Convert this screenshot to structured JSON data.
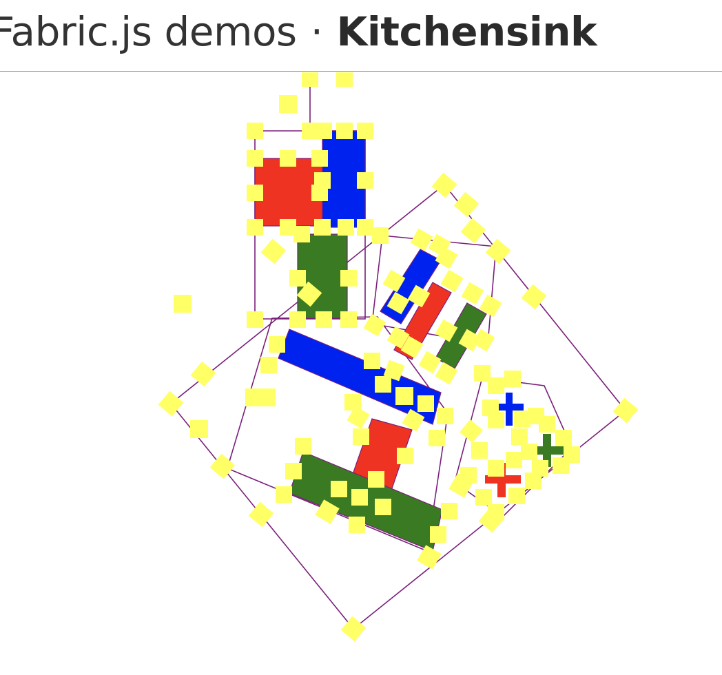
{
  "header": {
    "title_prefix": "Fabric.js demos",
    "separator": "·",
    "demo_name": "Kitchensink"
  },
  "colors": {
    "red": "#ee3322",
    "blue": "#0022ee",
    "green": "#3a7a22",
    "handle": "#ffff66",
    "selection_border": "#7a1f7a"
  },
  "canvas": {
    "objects": [
      "red-square",
      "blue-rect-top",
      "green-rect-top",
      "blue-bar-diagonal",
      "red-bar-diagonal",
      "green-bar-diagonal",
      "blue-plus",
      "green-plus",
      "red-plus",
      "blue-long-bar",
      "red-tall-bar",
      "green-long-bar"
    ]
  }
}
